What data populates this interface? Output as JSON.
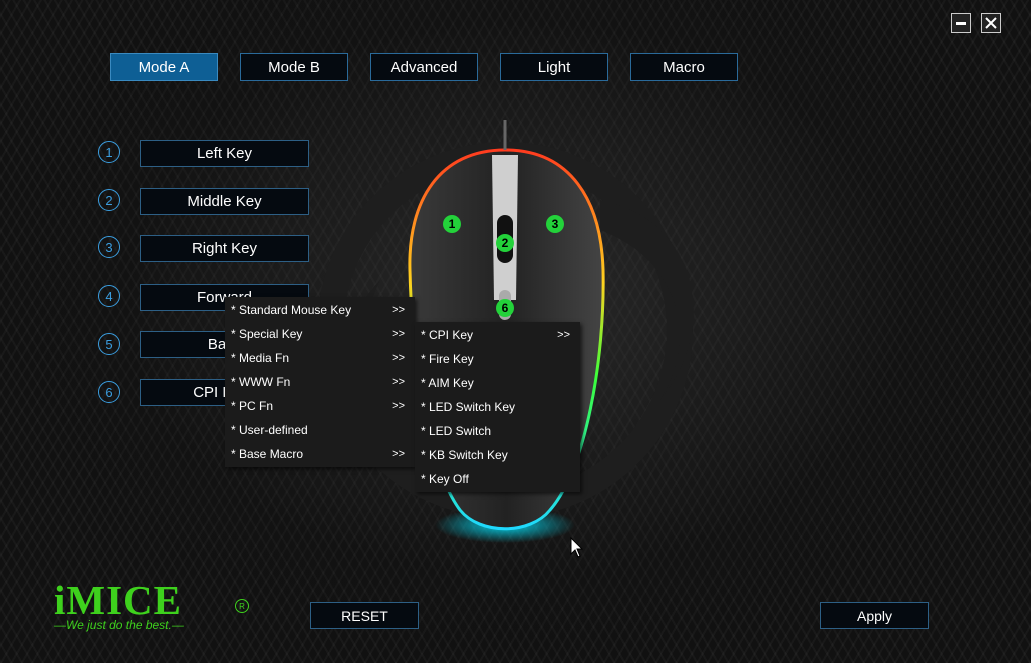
{
  "window": {
    "minimize_icon": "minimize-icon",
    "close_icon": "close-icon"
  },
  "tabs": [
    {
      "label": "Mode A",
      "active": true
    },
    {
      "label": "Mode B"
    },
    {
      "label": "Advanced"
    },
    {
      "label": "Light"
    },
    {
      "label": "Macro"
    }
  ],
  "keys": [
    {
      "num": "1",
      "label": "Left Key"
    },
    {
      "num": "2",
      "label": "Middle Key"
    },
    {
      "num": "3",
      "label": "Right Key"
    },
    {
      "num": "4",
      "label": "Forward"
    },
    {
      "num": "5",
      "label": "Back"
    },
    {
      "num": "6",
      "label": "CPI Loop"
    }
  ],
  "mouse_markers": [
    "1",
    "2",
    "3",
    "6"
  ],
  "context_menu": {
    "items": [
      {
        "label": "* Standard Mouse Key",
        "arrow": ">>"
      },
      {
        "label": "* Special Key",
        "arrow": ">>"
      },
      {
        "label": "* Media Fn",
        "arrow": ">>"
      },
      {
        "label": "* WWW Fn",
        "arrow": ">>"
      },
      {
        "label": "* PC Fn",
        "arrow": ">>"
      },
      {
        "label": "* User-defined",
        "arrow": ""
      },
      {
        "label": "* Base Macro",
        "arrow": ">>"
      }
    ]
  },
  "submenu": {
    "items": [
      {
        "label": "* CPI Key",
        "arrow": ">>"
      },
      {
        "label": "* Fire Key",
        "arrow": ""
      },
      {
        "label": "* AIM Key",
        "arrow": ""
      },
      {
        "label": "* LED Switch Key",
        "arrow": ""
      },
      {
        "label": "* LED Switch",
        "arrow": ""
      },
      {
        "label": "* KB Switch Key",
        "arrow": ""
      },
      {
        "label": "* Key Off",
        "arrow": ""
      }
    ]
  },
  "bottom": {
    "reset": "RESET",
    "apply": "Apply"
  },
  "logo": {
    "name": "iMICE",
    "reg": "R",
    "tagline": "—We just do the best.—"
  },
  "colors": {
    "accent": "#0e5f95",
    "ring": "#3b9ee0",
    "brand_green": "#3ed11d",
    "marker_green": "#23d23a"
  }
}
